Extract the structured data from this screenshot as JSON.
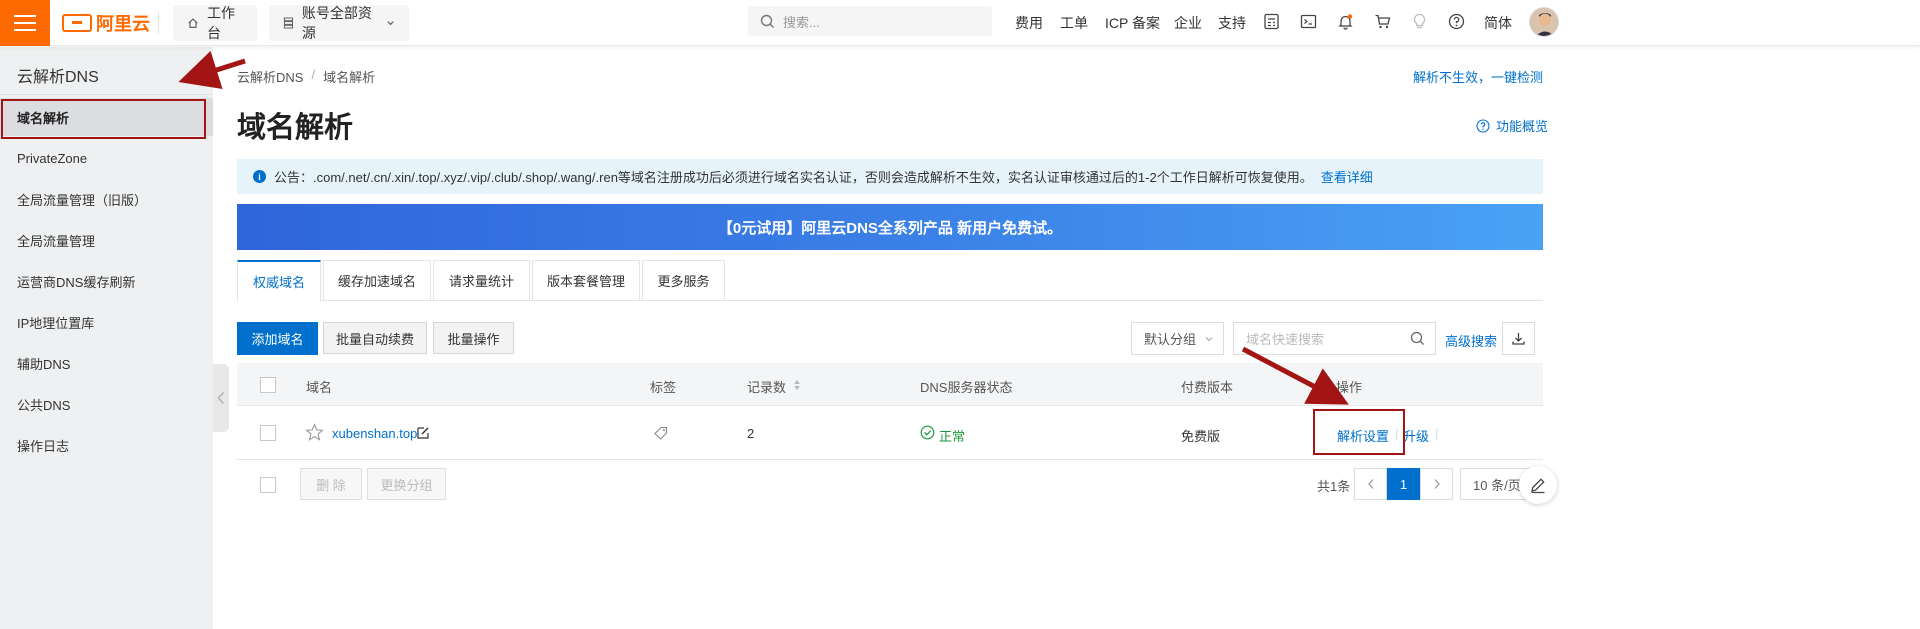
{
  "topbar": {
    "logo_text": "阿里云",
    "workbench_label": "工作台",
    "resources_label": "账号全部资源",
    "search_placeholder": "搜索...",
    "nav_links": [
      "费用",
      "工单",
      "ICP 备案",
      "企业",
      "支持"
    ],
    "language_label": "简体",
    "icons": [
      "calculator-icon",
      "terminal-icon",
      "bell-icon",
      "cart-icon",
      "lightbulb-icon",
      "help-icon"
    ],
    "accent_color": "#ff6a00"
  },
  "sidebar": {
    "title": "云解析DNS",
    "items": [
      {
        "label": "域名解析",
        "active": true
      },
      {
        "label": "PrivateZone"
      },
      {
        "label": "全局流量管理（旧版）"
      },
      {
        "label": "全局流量管理"
      },
      {
        "label": "运营商DNS缓存刷新"
      },
      {
        "label": "IP地理位置库"
      },
      {
        "label": "辅助DNS"
      },
      {
        "label": "公共DNS"
      },
      {
        "label": "操作日志"
      }
    ]
  },
  "main": {
    "breadcrumb": [
      "云解析DNS",
      "域名解析"
    ],
    "breadcrumb_sep": "/",
    "top_right_link": "解析不生效，一键检测",
    "title": "域名解析",
    "overview_link": "功能概览",
    "notice_text": "公告：.com/.net/.cn/.xin/.top/.xyz/.vip/.club/.shop/.wang/.ren等域名注册成功后必须进行域名实名认证，否则会造成解析不生效，实名认证审核通过后的1-2个工作日解析可恢复使用。",
    "notice_link": "查看详细",
    "banner_text": "【0元试用】阿里云DNS全系列产品 新用户免费试。",
    "tabs": [
      "权威域名",
      "缓存加速域名",
      "请求量统计",
      "版本套餐管理",
      "更多服务"
    ],
    "toolbar": {
      "add_domain": "添加域名",
      "batch_renew": "批量自动续费",
      "batch_ops": "批量操作",
      "group_select": "默认分组",
      "search_placeholder": "域名快速搜索",
      "advanced_search": "高级搜索"
    },
    "table": {
      "headers": [
        "域名",
        "标签",
        "记录数",
        "DNS服务器状态",
        "付费版本",
        "操作"
      ],
      "rows": [
        {
          "domain": "xubenshan.top",
          "records": "2",
          "dns_status": "正常",
          "edition": "免费版",
          "action_1": "解析设置",
          "action_2": "升级"
        }
      ]
    },
    "footer": {
      "delete_label": "删 除",
      "change_group_label": "更换分组",
      "total_label": "共1条",
      "current_page": "1",
      "page_size": "10 条/页"
    }
  }
}
